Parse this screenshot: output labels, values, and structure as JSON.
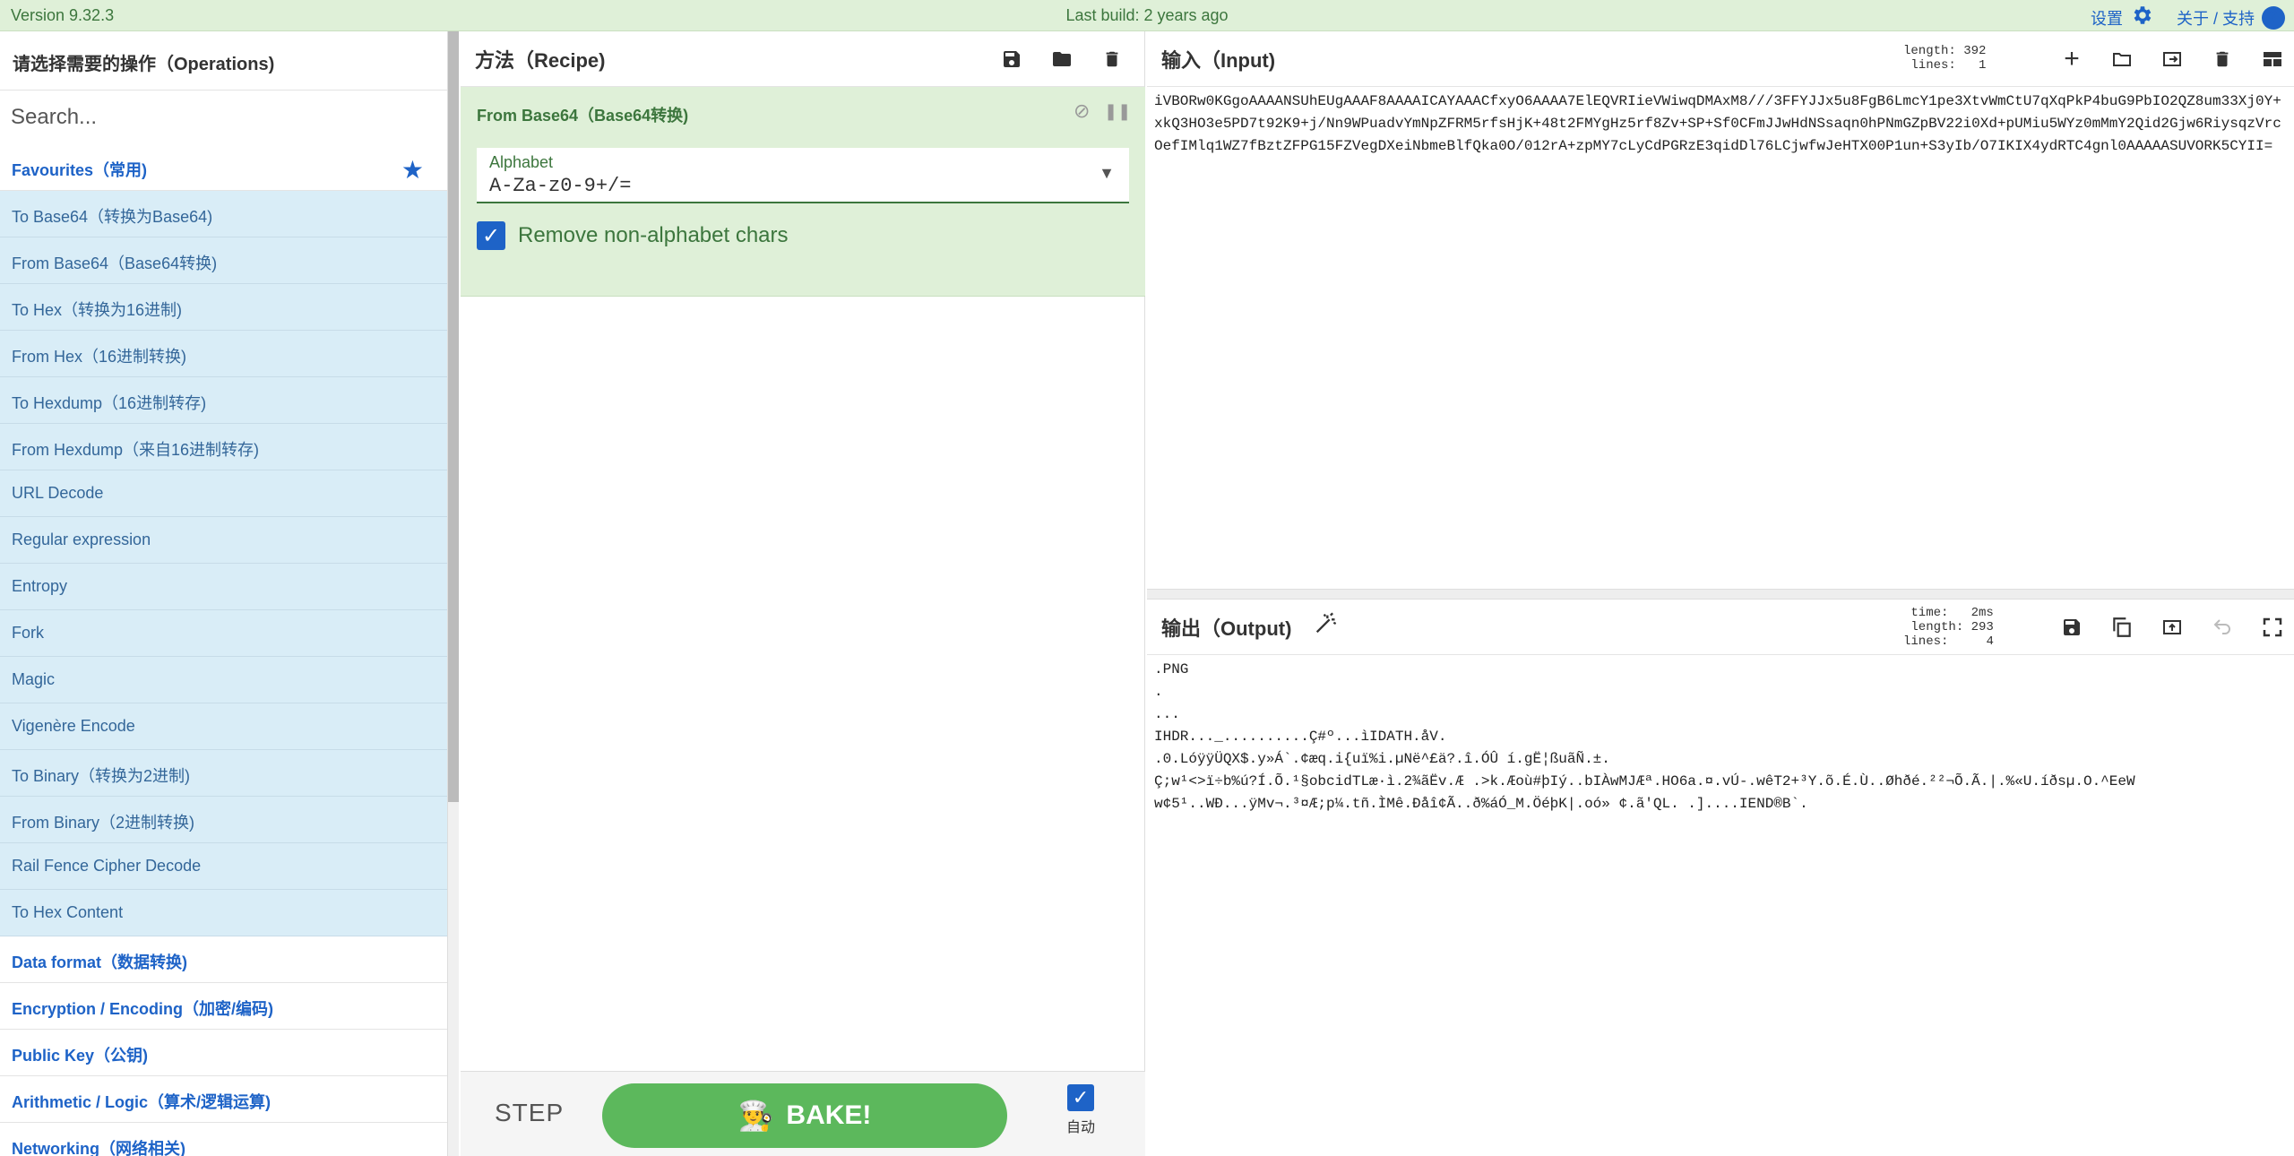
{
  "banner": {
    "version": "Version 9.32.3",
    "last_build": "Last build: 2 years ago",
    "settings_label": "设置",
    "about_label": "关于 / 支持"
  },
  "operations": {
    "title": "请选择需要的操作（Operations)",
    "search_placeholder": "Search...",
    "favourites_label": "Favourites（常用)",
    "favourites": [
      "To Base64（转换为Base64)",
      "From Base64（Base64转换)",
      "To Hex（转换为16进制)",
      "From Hex（16进制转换)",
      "To Hexdump（16进制转存)",
      "From Hexdump（来自16进制转存)",
      "URL Decode",
      "Regular expression",
      "Entropy",
      "Fork",
      "Magic",
      "Vigenère Encode",
      "To Binary（转换为2进制)",
      "From Binary（2进制转换)",
      "Rail Fence Cipher Decode",
      "To Hex Content"
    ],
    "categories": [
      "Data format（数据转换)",
      "Encryption / Encoding（加密/编码)",
      "Public Key（公钥)",
      "Arithmetic / Logic（算术/逻辑运算)",
      "Networking（网络相关)"
    ]
  },
  "recipe": {
    "title": "方法（Recipe)",
    "operation_name": "From Base64（Base64转换)",
    "alphabet_label": "Alphabet",
    "alphabet_value": "A-Za-z0-9+/=",
    "remove_label": "Remove non-alphabet chars",
    "step_label": "STEP",
    "bake_label": "BAKE!",
    "auto_label": "自动"
  },
  "input": {
    "title": "输入（Input)",
    "length_label": "length:",
    "length_value": "392",
    "lines_label": "lines:",
    "lines_value": "1",
    "text": "iVBORw0KGgoAAAANSUhEUgAAAF8AAAAICAYAAACfxyO6AAAA7ElEQVRIieVWiwqDMAxM8///3FFYJJx5u8FgB6LmcY1pe3XtvWmCtU7qXqPkP4buG9PbIO2QZ8um33Xj0Y+xkQ3HO3e5PD7t92K9+j/Nn9WPuadvYmNpZFRM5rfsHjK+48t2FMYgHz5rf8Zv+SP+Sf0CFmJJwHdNSsaqn0hPNmGZpBV22i0Xd+pUMiu5WYz0mMmY2Qid2Gjw6RiysqzVrcOefIMlq1WZ7fBztZFPG15FZVegDXeiNbmeBlfQka0O/012rA+zpMY7cLyCdPGRzE3qidDl76LCjwfwJeHTX00P1un+S3yIb/O7IKIX4ydRTC4gnl0AAAAASUVORK5CYII="
  },
  "output": {
    "title": "输出（Output)",
    "time_label": "time:",
    "time_value": "2ms",
    "length_label": "length:",
    "length_value": "293",
    "lines_label": "lines:",
    "lines_value": "4",
    "text": ".PNG\n.\n...\nIHDR..._..........Ç#º...ìIDATH.åV.\n.0.LóÿÿÜQX$.y»Á`.¢æq.i{uï%i.µNë^£ä?.î.ÓÛ í.gË¦ßuãÑ.±.\nÇ;w¹<>ï÷b%ú?Í.Õ.¹§obcidTLæ·ì.2¾ãËv.Æ .>k.Æoù#þIý..bIÀwMJÆª.HO6a.¤.vÚ-.wêT2+³Y.õ.É.Ù..Øhðé.²²¬Õ.Ã.|.%«U.íðsµ.O.^EeW\nw¢5¹..WÐ...ÿMv¬.³¤Æ;p¼.tñ.ÌMê.Ðåî¢Ã..ð%áÓ_M.ÖéþK|.oó» ¢.ã'QL. .]....IEND®B`."
  }
}
